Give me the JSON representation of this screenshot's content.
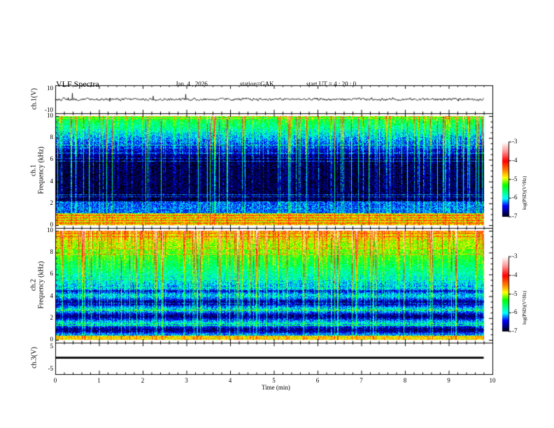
{
  "header": {
    "title": "VLF  Spectra",
    "date": "Jan. 4  , 2026",
    "station": "station=GAK",
    "start": "start  UT =   4  : 20 : 0"
  },
  "chart_data": [
    {
      "type": "line",
      "ylabel": "ch.1(V)",
      "ylim": [
        -10,
        10
      ],
      "yticks": [
        "10",
        "-10"
      ],
      "xlim": [
        0,
        10
      ],
      "description_values": {
        "mean": 0,
        "data_end_min": 9.8
      }
    },
    {
      "type": "heatmap",
      "ylabel_line1": "ch.1",
      "ylabel_line2": "Frequency  (kHz)",
      "ylim": [
        0,
        10
      ],
      "yticks": [
        "0",
        "2",
        "4",
        "6",
        "8",
        "10"
      ],
      "xlim": [
        0,
        10
      ],
      "colorbar": {
        "label": "log(PSD)(V²/Hz)",
        "range": [
          -7,
          -3
        ],
        "ticks": [
          "-3",
          "-4",
          "-5",
          "-6",
          "-7"
        ]
      }
    },
    {
      "type": "heatmap",
      "ylabel_line1": "ch.2",
      "ylabel_line2": "Frequency  (kHz)",
      "ylim": [
        0,
        10
      ],
      "yticks": [
        "0",
        "2",
        "4",
        "6",
        "8",
        "10"
      ],
      "xlim": [
        0,
        10
      ],
      "colorbar": {
        "label": "log(PSD)(V²/Hz)",
        "range": [
          -7,
          -3
        ],
        "ticks": [
          "-3",
          "-4",
          "-5",
          "-6",
          "-7"
        ]
      }
    },
    {
      "type": "line",
      "ylabel": "ch.3(V)",
      "ylim": [
        -5,
        5
      ],
      "yticks": [
        "5",
        "-5"
      ],
      "xlim": [
        0,
        10
      ],
      "description_values": {
        "mean": 0
      }
    }
  ],
  "xaxis": {
    "label": "Time  (min)",
    "ticks": [
      "0",
      "1",
      "2",
      "3",
      "4",
      "5",
      "6",
      "7",
      "8",
      "9",
      "10"
    ]
  },
  "colormap": [
    "#000000",
    "#00008c",
    "#0000ff",
    "#00ffff",
    "#00ff00",
    "#ffff00",
    "#ff8000",
    "#ff0000",
    "#ff9090",
    "#ffffff"
  ]
}
